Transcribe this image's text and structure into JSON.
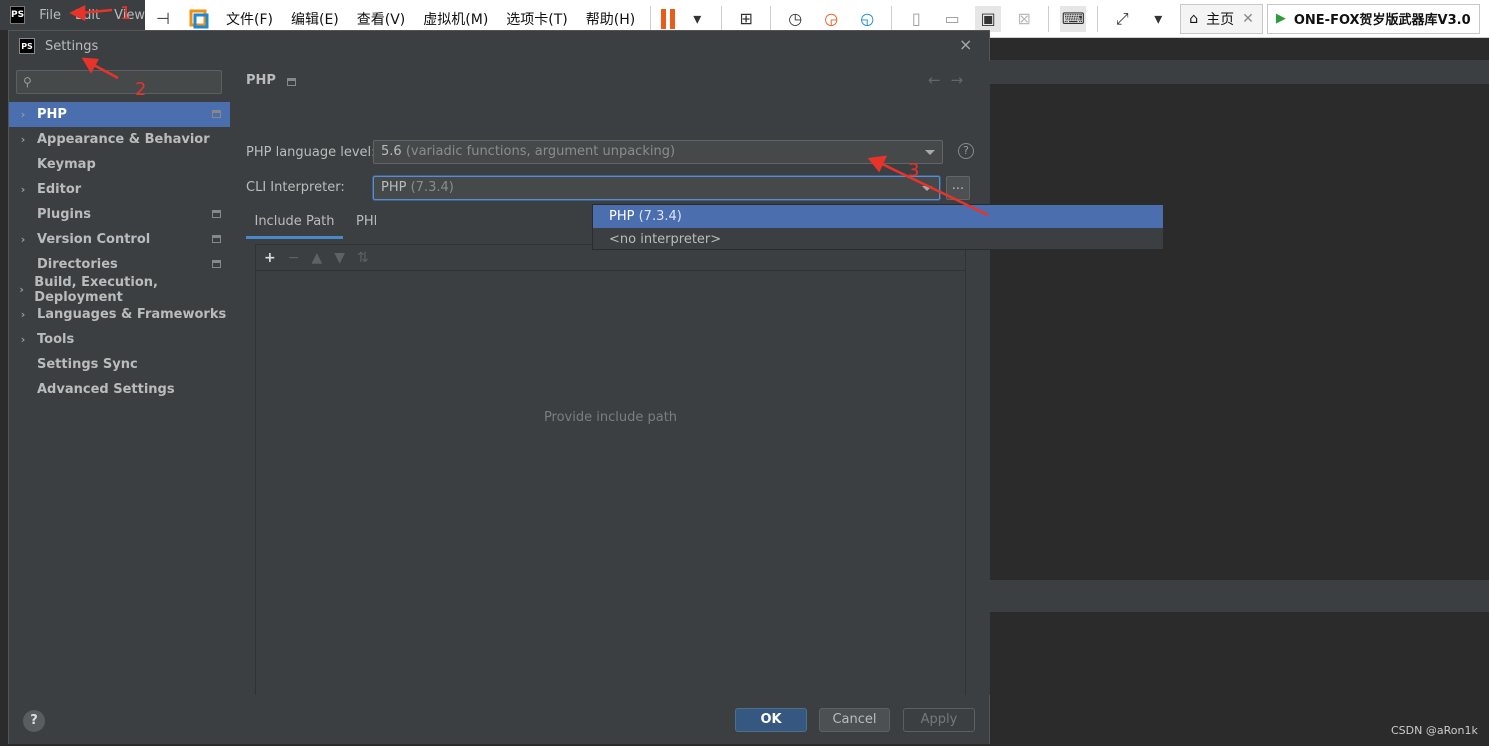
{
  "ide": {
    "menu": [
      "File",
      "Edit",
      "View"
    ],
    "logo_text": "PS"
  },
  "vmware": {
    "menus": [
      "文件(F)",
      "编辑(E)",
      "查看(V)",
      "虚拟机(M)",
      "选项卡(T)",
      "帮助(H)"
    ],
    "tabs": [
      {
        "label": "主页",
        "icon": "home-icon"
      },
      {
        "label": "ONE-FOX贺岁版武器库V3.0",
        "icon": "vm-play-icon"
      }
    ],
    "accent": "#e85d1a"
  },
  "dialog": {
    "title": "Settings",
    "close": "×",
    "search_placeholder": "",
    "nav": [
      {
        "label": "PHP",
        "arrow": true,
        "mark": true,
        "selected": true
      },
      {
        "label": "Appearance & Behavior",
        "arrow": true,
        "mark": false
      },
      {
        "label": "Keymap",
        "arrow": false,
        "mark": false
      },
      {
        "label": "Editor",
        "arrow": true,
        "mark": false
      },
      {
        "label": "Plugins",
        "arrow": false,
        "mark": true
      },
      {
        "label": "Version Control",
        "arrow": true,
        "mark": true
      },
      {
        "label": "Directories",
        "arrow": false,
        "mark": true
      },
      {
        "label": "Build, Execution, Deployment",
        "arrow": true,
        "mark": false
      },
      {
        "label": "Languages & Frameworks",
        "arrow": true,
        "mark": false
      },
      {
        "label": "Tools",
        "arrow": true,
        "mark": false
      },
      {
        "label": "Settings Sync",
        "arrow": false,
        "mark": false
      },
      {
        "label": "Advanced Settings",
        "arrow": false,
        "mark": false
      }
    ],
    "content": {
      "title": "PHP",
      "language_level_label": "PHP language level:",
      "language_level_value": "5.6",
      "language_level_desc": "(variadic functions, argument unpacking)",
      "cli_label": "CLI Interpreter:",
      "cli_value": "PHP",
      "cli_version": "(7.3.4)",
      "tabs": [
        "Include Path",
        "PHP Runtime"
      ],
      "dropdown_options": [
        {
          "name": "PHP",
          "detail": "(7.3.4)"
        },
        {
          "name": "<no interpreter>",
          "detail": ""
        }
      ],
      "empty_text": "Provide include path",
      "ellipsis": "..."
    },
    "footer": {
      "ok": "OK",
      "cancel": "Cancel",
      "apply": "Apply",
      "help": "?"
    }
  },
  "annotations": [
    "1",
    "2",
    "3"
  ],
  "watermark": "CSDN @aRon1k"
}
